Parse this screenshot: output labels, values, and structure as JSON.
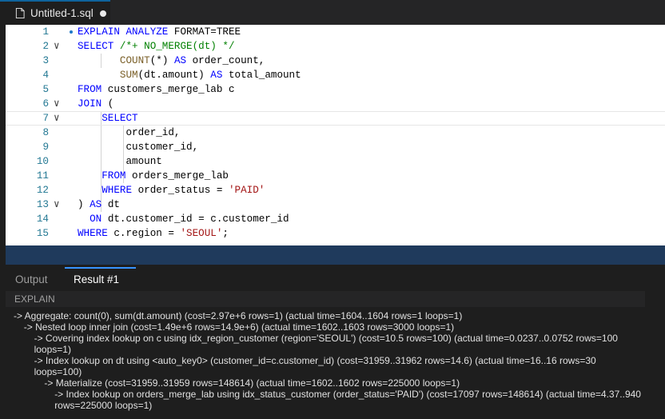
{
  "tab": {
    "title": "Untitled-1.sql"
  },
  "editor": {
    "lines": [
      {
        "n": "1",
        "parts": [
          [
            "kw",
            "EXPLAIN ANALYZE "
          ],
          [
            "id",
            "FORMAT=TREE"
          ]
        ]
      },
      {
        "n": "2",
        "parts": [
          [
            "kw",
            "SELECT "
          ],
          [
            "cm",
            "/*+ NO_MERGE(dt) */"
          ]
        ]
      },
      {
        "n": "3",
        "parts": [
          [
            "id",
            "       "
          ],
          [
            "fn",
            "COUNT"
          ],
          [
            "id",
            "(*) "
          ],
          [
            "kw",
            "AS "
          ],
          [
            "id",
            "order_count,"
          ]
        ]
      },
      {
        "n": "4",
        "parts": [
          [
            "id",
            "       "
          ],
          [
            "fn",
            "SUM"
          ],
          [
            "id",
            "(dt.amount) "
          ],
          [
            "kw",
            "AS "
          ],
          [
            "id",
            "total_amount"
          ]
        ]
      },
      {
        "n": "5",
        "parts": [
          [
            "kw",
            "FROM "
          ],
          [
            "id",
            "customers_merge_lab c"
          ]
        ]
      },
      {
        "n": "6",
        "parts": [
          [
            "kw",
            "JOIN "
          ],
          [
            "id",
            "("
          ]
        ]
      },
      {
        "n": "7",
        "parts": [
          [
            "id",
            "    "
          ],
          [
            "kw",
            "SELECT"
          ]
        ]
      },
      {
        "n": "8",
        "parts": [
          [
            "id",
            "        order_id,"
          ]
        ]
      },
      {
        "n": "9",
        "parts": [
          [
            "id",
            "        customer_id,"
          ]
        ]
      },
      {
        "n": "10",
        "parts": [
          [
            "id",
            "        amount"
          ]
        ]
      },
      {
        "n": "11",
        "parts": [
          [
            "id",
            "    "
          ],
          [
            "kw",
            "FROM "
          ],
          [
            "id",
            "orders_merge_lab"
          ]
        ]
      },
      {
        "n": "12",
        "parts": [
          [
            "id",
            "    "
          ],
          [
            "kw",
            "WHERE "
          ],
          [
            "id",
            "order_status = "
          ],
          [
            "str",
            "'PAID'"
          ]
        ]
      },
      {
        "n": "13",
        "parts": [
          [
            "id",
            ") "
          ],
          [
            "kw",
            "AS "
          ],
          [
            "id",
            "dt"
          ]
        ]
      },
      {
        "n": "14",
        "parts": [
          [
            "id",
            "  "
          ],
          [
            "kw",
            "ON "
          ],
          [
            "id",
            "dt.customer_id = c.customer_id"
          ]
        ]
      },
      {
        "n": "15",
        "parts": [
          [
            "kw",
            "WHERE "
          ],
          [
            "id",
            "c.region = "
          ],
          [
            "str",
            "'SEOUL'"
          ],
          [
            "id",
            ";"
          ]
        ]
      }
    ]
  },
  "panel": {
    "tabs": [
      "Output",
      "Result #1"
    ],
    "active_tab": "Result #1",
    "column_header": "EXPLAIN",
    "plan_rows": [
      "-> Aggregate: count(0), sum(dt.amount)  (cost=2.97e+6 rows=1) (actual time=1604..1604 rows=1 loops=1)",
      "    -> Nested loop inner join  (cost=1.49e+6 rows=14.9e+6) (actual time=1602..1603 rows=3000 loops=1)",
      "        -> Covering index lookup on c using idx_region_customer (region='SEOUL')  (cost=10.5 rows=100) (actual time=0.0237..0.0752 rows=100 loops=1)",
      "        -> Index lookup on dt using <auto_key0> (customer_id=c.customer_id)  (cost=31959..31962 rows=14.6) (actual time=16..16 rows=30 loops=100)",
      "            -> Materialize  (cost=31959..31959 rows=148614) (actual time=1602..1602 rows=225000 loops=1)",
      "                -> Index lookup on orders_merge_lab using idx_status_customer (order_status='PAID')  (cost=17097 rows=148614) (actual time=4.37..940 rows=225000 loops=1)"
    ]
  }
}
